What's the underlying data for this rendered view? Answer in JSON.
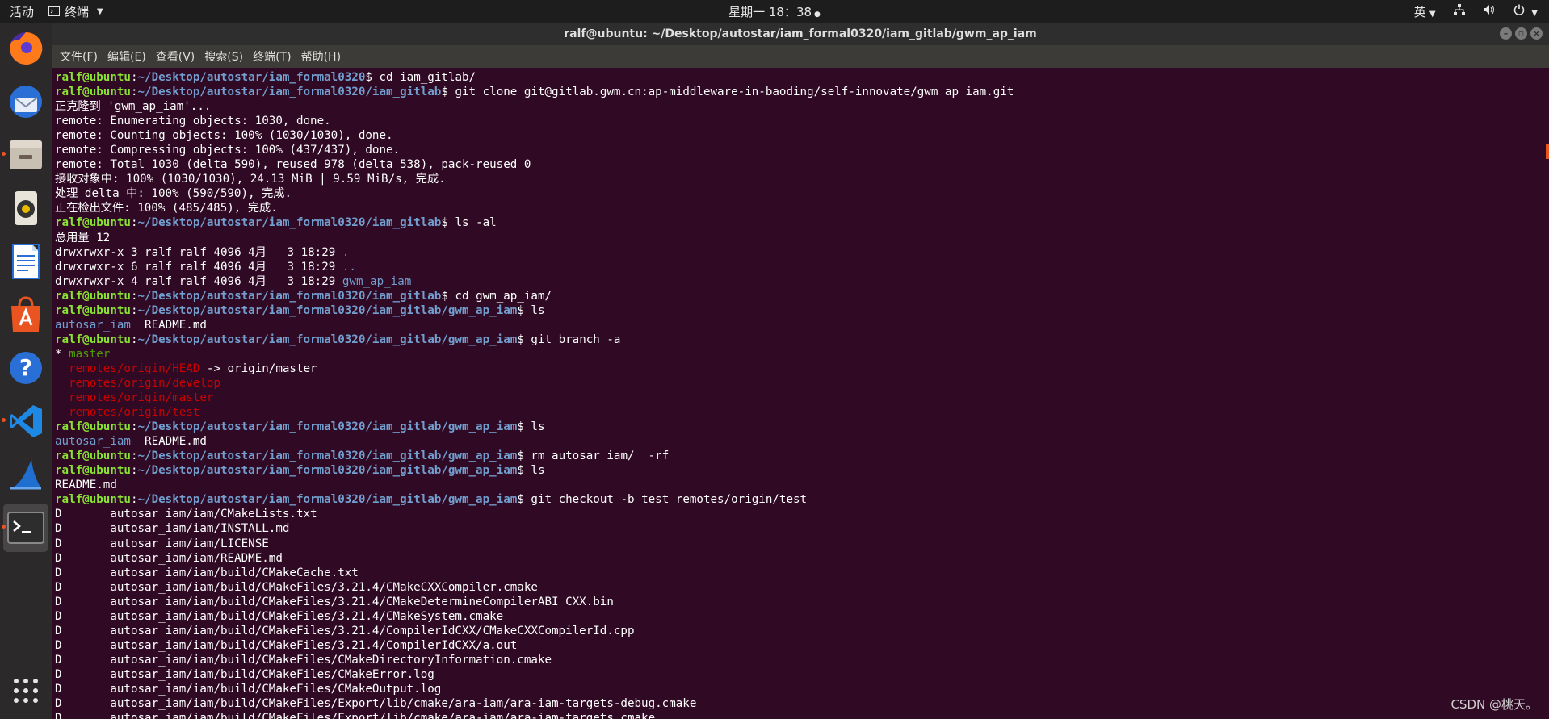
{
  "topbar": {
    "activities": "活动",
    "app_name": "终端",
    "clock": "星期一 18：38",
    "input_method": "英"
  },
  "window": {
    "title": "ralf@ubuntu: ~/Desktop/autostar/iam_formal0320/iam_gitlab/gwm_ap_iam"
  },
  "menubar": {
    "items": [
      "文件(F)",
      "编辑(E)",
      "查看(V)",
      "搜索(S)",
      "终端(T)",
      "帮助(H)"
    ]
  },
  "dock": {
    "items": [
      "firefox-icon",
      "thunderbird-icon",
      "files-icon",
      "rhythmbox-icon",
      "writer-icon",
      "software-icon",
      "help-icon",
      "vscode-icon",
      "wireshark-icon",
      "terminal-icon"
    ]
  },
  "prompt_user": "ralf@ubuntu",
  "terminal": [
    {
      "path": "~/Desktop/autostar/iam_formal0320",
      "cmd": "cd iam_gitlab/"
    },
    {
      "path": "~/Desktop/autostar/iam_formal0320/iam_gitlab",
      "cmd": "git clone git@gitlab.gwm.cn:ap-middleware-in-baoding/self-innovate/gwm_ap_iam.git"
    },
    {
      "text": "正克隆到 'gwm_ap_iam'..."
    },
    {
      "text": "remote: Enumerating objects: 1030, done."
    },
    {
      "text": "remote: Counting objects: 100% (1030/1030), done."
    },
    {
      "text": "remote: Compressing objects: 100% (437/437), done."
    },
    {
      "text": "remote: Total 1030 (delta 590), reused 978 (delta 538), pack-reused 0"
    },
    {
      "text": "接收对象中: 100% (1030/1030), 24.13 MiB | 9.59 MiB/s, 完成."
    },
    {
      "text": "处理 delta 中: 100% (590/590), 完成."
    },
    {
      "text": "正在检出文件: 100% (485/485), 完成."
    },
    {
      "path": "~/Desktop/autostar/iam_formal0320/iam_gitlab",
      "cmd": "ls -al"
    },
    {
      "text": "总用量 12"
    },
    {
      "text": "drwxrwxr-x 3 ralf ralf 4096 4月   3 18:29 ",
      "dir": "."
    },
    {
      "text": "drwxrwxr-x 6 ralf ralf 4096 4月   3 18:29 ",
      "dir": ".."
    },
    {
      "text": "drwxrwxr-x 4 ralf ralf 4096 4月   3 18:29 ",
      "dir": "gwm_ap_iam"
    },
    {
      "path": "~/Desktop/autostar/iam_formal0320/iam_gitlab",
      "cmd": "cd gwm_ap_iam/"
    },
    {
      "path": "~/Desktop/autostar/iam_formal0320/iam_gitlab/gwm_ap_iam",
      "cmd": "ls"
    },
    {
      "dir": "autosar_iam",
      "text": "  README.md"
    },
    {
      "path": "~/Desktop/autostar/iam_formal0320/iam_gitlab/gwm_ap_iam",
      "cmd": "git branch -a"
    },
    {
      "star": "* ",
      "current": "master"
    },
    {
      "text": "  ",
      "remote": "remotes/origin/HEAD",
      "rest": " -> origin/master"
    },
    {
      "text": "  ",
      "remote": "remotes/origin/develop"
    },
    {
      "text": "  ",
      "remote": "remotes/origin/master"
    },
    {
      "text": "  ",
      "remote": "remotes/origin/test"
    },
    {
      "path": "~/Desktop/autostar/iam_formal0320/iam_gitlab/gwm_ap_iam",
      "cmd": "ls"
    },
    {
      "dir": "autosar_iam",
      "text": "  README.md"
    },
    {
      "path": "~/Desktop/autostar/iam_formal0320/iam_gitlab/gwm_ap_iam",
      "cmd": "rm autosar_iam/  -rf"
    },
    {
      "path": "~/Desktop/autostar/iam_formal0320/iam_gitlab/gwm_ap_iam",
      "cmd": "ls"
    },
    {
      "text": "README.md"
    },
    {
      "path": "~/Desktop/autostar/iam_formal0320/iam_gitlab/gwm_ap_iam",
      "cmd": "git checkout -b test remotes/origin/test"
    },
    {
      "text": "D       autosar_iam/iam/CMakeLists.txt"
    },
    {
      "text": "D       autosar_iam/iam/INSTALL.md"
    },
    {
      "text": "D       autosar_iam/iam/LICENSE"
    },
    {
      "text": "D       autosar_iam/iam/README.md"
    },
    {
      "text": "D       autosar_iam/iam/build/CMakeCache.txt"
    },
    {
      "text": "D       autosar_iam/iam/build/CMakeFiles/3.21.4/CMakeCXXCompiler.cmake"
    },
    {
      "text": "D       autosar_iam/iam/build/CMakeFiles/3.21.4/CMakeDetermineCompilerABI_CXX.bin"
    },
    {
      "text": "D       autosar_iam/iam/build/CMakeFiles/3.21.4/CMakeSystem.cmake"
    },
    {
      "text": "D       autosar_iam/iam/build/CMakeFiles/3.21.4/CompilerIdCXX/CMakeCXXCompilerId.cpp"
    },
    {
      "text": "D       autosar_iam/iam/build/CMakeFiles/3.21.4/CompilerIdCXX/a.out"
    },
    {
      "text": "D       autosar_iam/iam/build/CMakeFiles/CMakeDirectoryInformation.cmake"
    },
    {
      "text": "D       autosar_iam/iam/build/CMakeFiles/CMakeError.log"
    },
    {
      "text": "D       autosar_iam/iam/build/CMakeFiles/CMakeOutput.log"
    },
    {
      "text": "D       autosar_iam/iam/build/CMakeFiles/Export/lib/cmake/ara-iam/ara-iam-targets-debug.cmake"
    },
    {
      "text": "D       autosar_iam/iam/build/CMakeFiles/Export/lib/cmake/ara-iam/ara-iam-targets.cmake"
    }
  ],
  "watermark": "CSDN @桃天。"
}
